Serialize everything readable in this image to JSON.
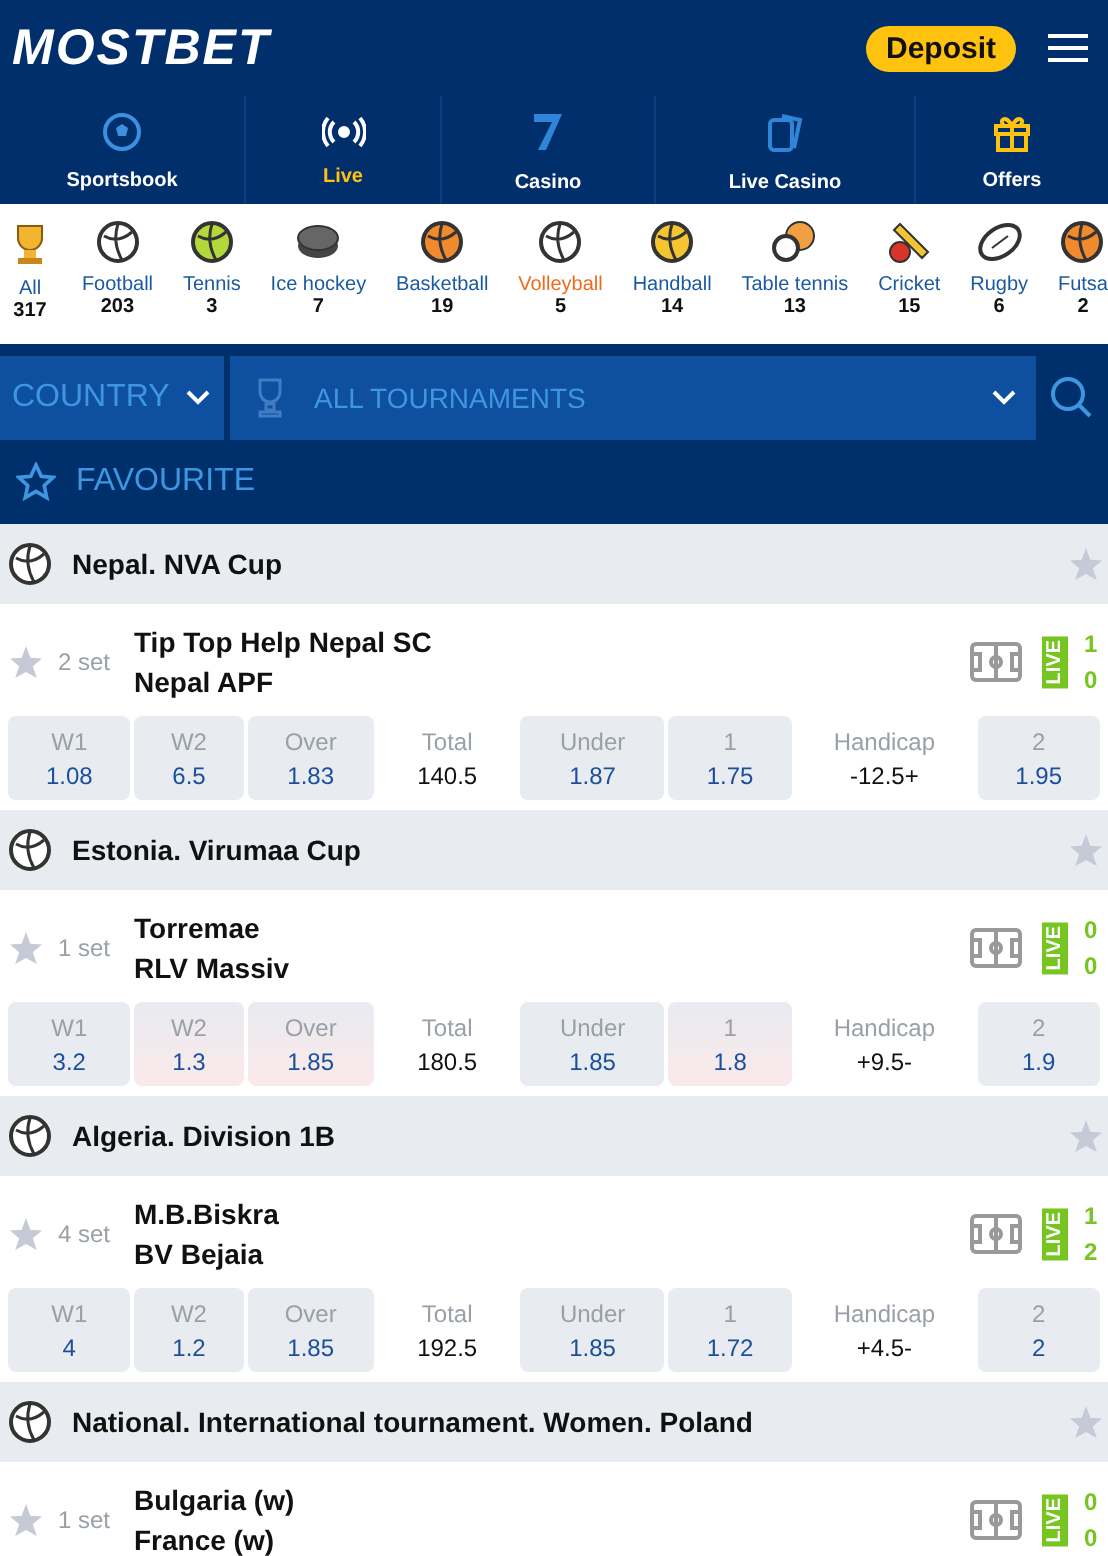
{
  "header": {
    "logo": "MOSTBET",
    "deposit": "Deposit"
  },
  "nav": [
    {
      "label": "Sportsbook",
      "selected": false
    },
    {
      "label": "Live",
      "selected": true
    },
    {
      "label": "Casino",
      "selected": false
    },
    {
      "label": "Live Casino",
      "selected": false
    },
    {
      "label": "Offers",
      "selected": false
    }
  ],
  "sports": [
    {
      "label": "All",
      "count": "317",
      "selected": false
    },
    {
      "label": "Football",
      "count": "203",
      "selected": false
    },
    {
      "label": "Tennis",
      "count": "3",
      "selected": false
    },
    {
      "label": "Ice hockey",
      "count": "7",
      "selected": false
    },
    {
      "label": "Basketball",
      "count": "19",
      "selected": false
    },
    {
      "label": "Volleyball",
      "count": "5",
      "selected": true
    },
    {
      "label": "Handball",
      "count": "14",
      "selected": false
    },
    {
      "label": "Table tennis",
      "count": "13",
      "selected": false
    },
    {
      "label": "Cricket",
      "count": "15",
      "selected": false
    },
    {
      "label": "Rugby",
      "count": "6",
      "selected": false
    },
    {
      "label": "Futsa",
      "count": "2",
      "selected": false
    }
  ],
  "filters": {
    "country": "COUNTRY",
    "tournaments": "ALL TOURNAMENTS"
  },
  "favourite": "FAVOURITE",
  "leagues": [
    {
      "name": "Nepal. NVA Cup",
      "match": {
        "period": "2 set",
        "team1": "Tip Top Help Nepal SC",
        "team2": "Nepal APF",
        "live": "LIVE",
        "score1": "1",
        "score2": "0",
        "odds": [
          {
            "kind": "odd",
            "label": "W1",
            "value": "1.08",
            "changed": false
          },
          {
            "kind": "odd",
            "label": "W2",
            "value": "6.5",
            "changed": false
          },
          {
            "kind": "odd",
            "label": "Over",
            "value": "1.83",
            "changed": false
          },
          {
            "kind": "param",
            "label": "Total",
            "value": "140.5"
          },
          {
            "kind": "odd",
            "label": "Under",
            "value": "1.87",
            "changed": false
          },
          {
            "kind": "odd",
            "label": "1",
            "value": "1.75",
            "changed": false
          },
          {
            "kind": "param",
            "label": "Handicap",
            "value": "-12.5+"
          },
          {
            "kind": "odd",
            "label": "2",
            "value": "1.95",
            "changed": false
          }
        ]
      }
    },
    {
      "name": "Estonia. Virumaa Cup",
      "match": {
        "period": "1 set",
        "team1": "Torremae",
        "team2": "RLV Massiv",
        "live": "LIVE",
        "score1": "0",
        "score2": "0",
        "odds": [
          {
            "kind": "odd",
            "label": "W1",
            "value": "3.2",
            "changed": false
          },
          {
            "kind": "odd",
            "label": "W2",
            "value": "1.3",
            "changed": true
          },
          {
            "kind": "odd",
            "label": "Over",
            "value": "1.85",
            "changed": true
          },
          {
            "kind": "param",
            "label": "Total",
            "value": "180.5"
          },
          {
            "kind": "odd",
            "label": "Under",
            "value": "1.85",
            "changed": false
          },
          {
            "kind": "odd",
            "label": "1",
            "value": "1.8",
            "changed": true
          },
          {
            "kind": "param",
            "label": "Handicap",
            "value": "+9.5-"
          },
          {
            "kind": "odd",
            "label": "2",
            "value": "1.9",
            "changed": false
          }
        ]
      }
    },
    {
      "name": "Algeria. Division 1B",
      "match": {
        "period": "4 set",
        "team1": "M.B.Biskra",
        "team2": "BV Bejaia",
        "live": "LIVE",
        "score1": "1",
        "score2": "2",
        "odds": [
          {
            "kind": "odd",
            "label": "W1",
            "value": "4",
            "changed": false
          },
          {
            "kind": "odd",
            "label": "W2",
            "value": "1.2",
            "changed": false
          },
          {
            "kind": "odd",
            "label": "Over",
            "value": "1.85",
            "changed": false
          },
          {
            "kind": "param",
            "label": "Total",
            "value": "192.5"
          },
          {
            "kind": "odd",
            "label": "Under",
            "value": "1.85",
            "changed": false
          },
          {
            "kind": "odd",
            "label": "1",
            "value": "1.72",
            "changed": false
          },
          {
            "kind": "param",
            "label": "Handicap",
            "value": "+4.5-"
          },
          {
            "kind": "odd",
            "label": "2",
            "value": "2",
            "changed": false
          }
        ]
      }
    },
    {
      "name": "National. International tournament. Women. Poland",
      "match": {
        "period": "1 set",
        "team1": "Bulgaria (w)",
        "team2": "France (w)",
        "live": "LIVE",
        "score1": "0",
        "score2": "0"
      }
    }
  ]
}
